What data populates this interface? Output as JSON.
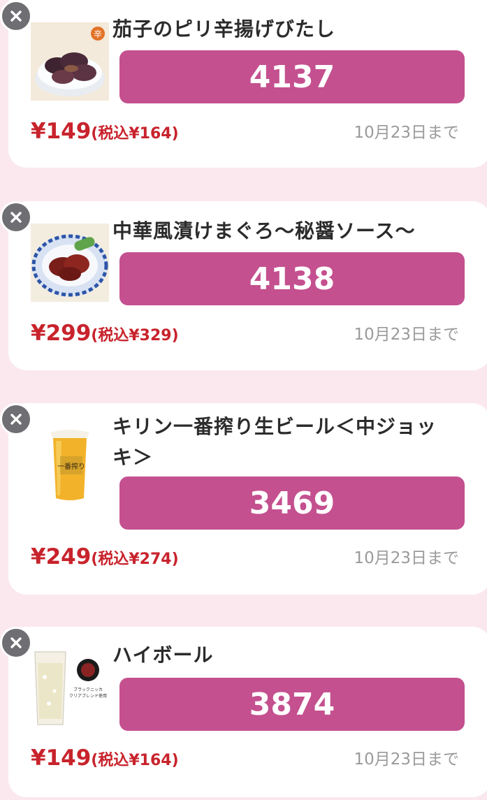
{
  "coupons": [
    {
      "name": "茄子のピリ辛揚げびたし",
      "code": "4137",
      "price": "¥149",
      "tax_price": "(税込¥164)",
      "deadline": "10月23日まで",
      "image": "eggplant-dish",
      "image_badge": "辛"
    },
    {
      "name": "中華風漬けまぐろ〜秘醤ソース〜",
      "code": "4138",
      "price": "¥299",
      "tax_price": "(税込¥329)",
      "deadline": "10月23日まで",
      "image": "tuna-dish"
    },
    {
      "name": "キリン一番搾り生ビール＜中ジョッキ＞",
      "code": "3469",
      "price": "¥249",
      "tax_price": "(税込¥274)",
      "deadline": "10月23日まで",
      "image": "beer-mug",
      "image_text": "一番搾り"
    },
    {
      "name": "ハイボール",
      "code": "3874",
      "price": "¥149",
      "tax_price": "(税込¥164)",
      "deadline": "10月23日まで",
      "image": "highball-glass",
      "image_text_1": "ブラックニッカ",
      "image_text_2": "クリアブレンド使用"
    }
  ],
  "colors": {
    "accent": "#c4508f",
    "price": "#c8232c",
    "background": "#fbe8ef"
  }
}
